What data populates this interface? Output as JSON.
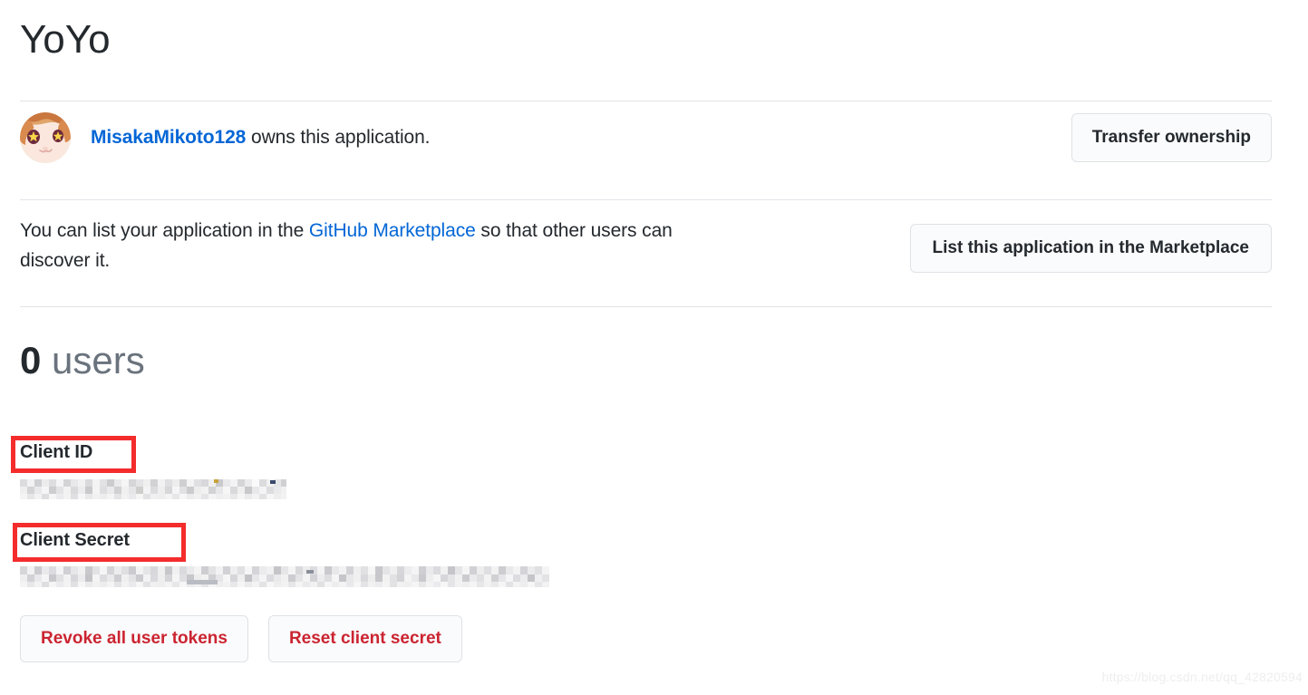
{
  "app": {
    "title": "YoYo"
  },
  "owner": {
    "username": "MisakaMikoto128",
    "sentence_suffix": " owns this application.",
    "avatar_alt": "user-avatar",
    "transfer_button": "Transfer ownership"
  },
  "marketplace": {
    "text_before": "You can list your application in the ",
    "link": "GitHub Marketplace",
    "text_after": " so that other users can discover it.",
    "button": "List this application in the Marketplace"
  },
  "users": {
    "count": "0",
    "label": "users"
  },
  "credentials": {
    "client_id_label": "Client ID",
    "client_id_value": "",
    "client_secret_label": "Client Secret",
    "client_secret_value": "",
    "client_id_redacted": true,
    "client_secret_redacted": true
  },
  "actions": {
    "revoke_tokens": "Revoke all user tokens",
    "reset_secret": "Reset client secret"
  },
  "annotations": {
    "highlight_color": "#f42c2c",
    "highlighted_labels": [
      "Client ID",
      "Client Secret"
    ]
  },
  "watermark": {
    "text": "https://blog.csdn.net/qq_42820594"
  },
  "colors": {
    "link": "#0366d6",
    "danger": "#cb2431",
    "text": "#24292e",
    "muted": "#6a737d",
    "border": "#e1e4e8",
    "button_bg": "#fafbfc"
  }
}
